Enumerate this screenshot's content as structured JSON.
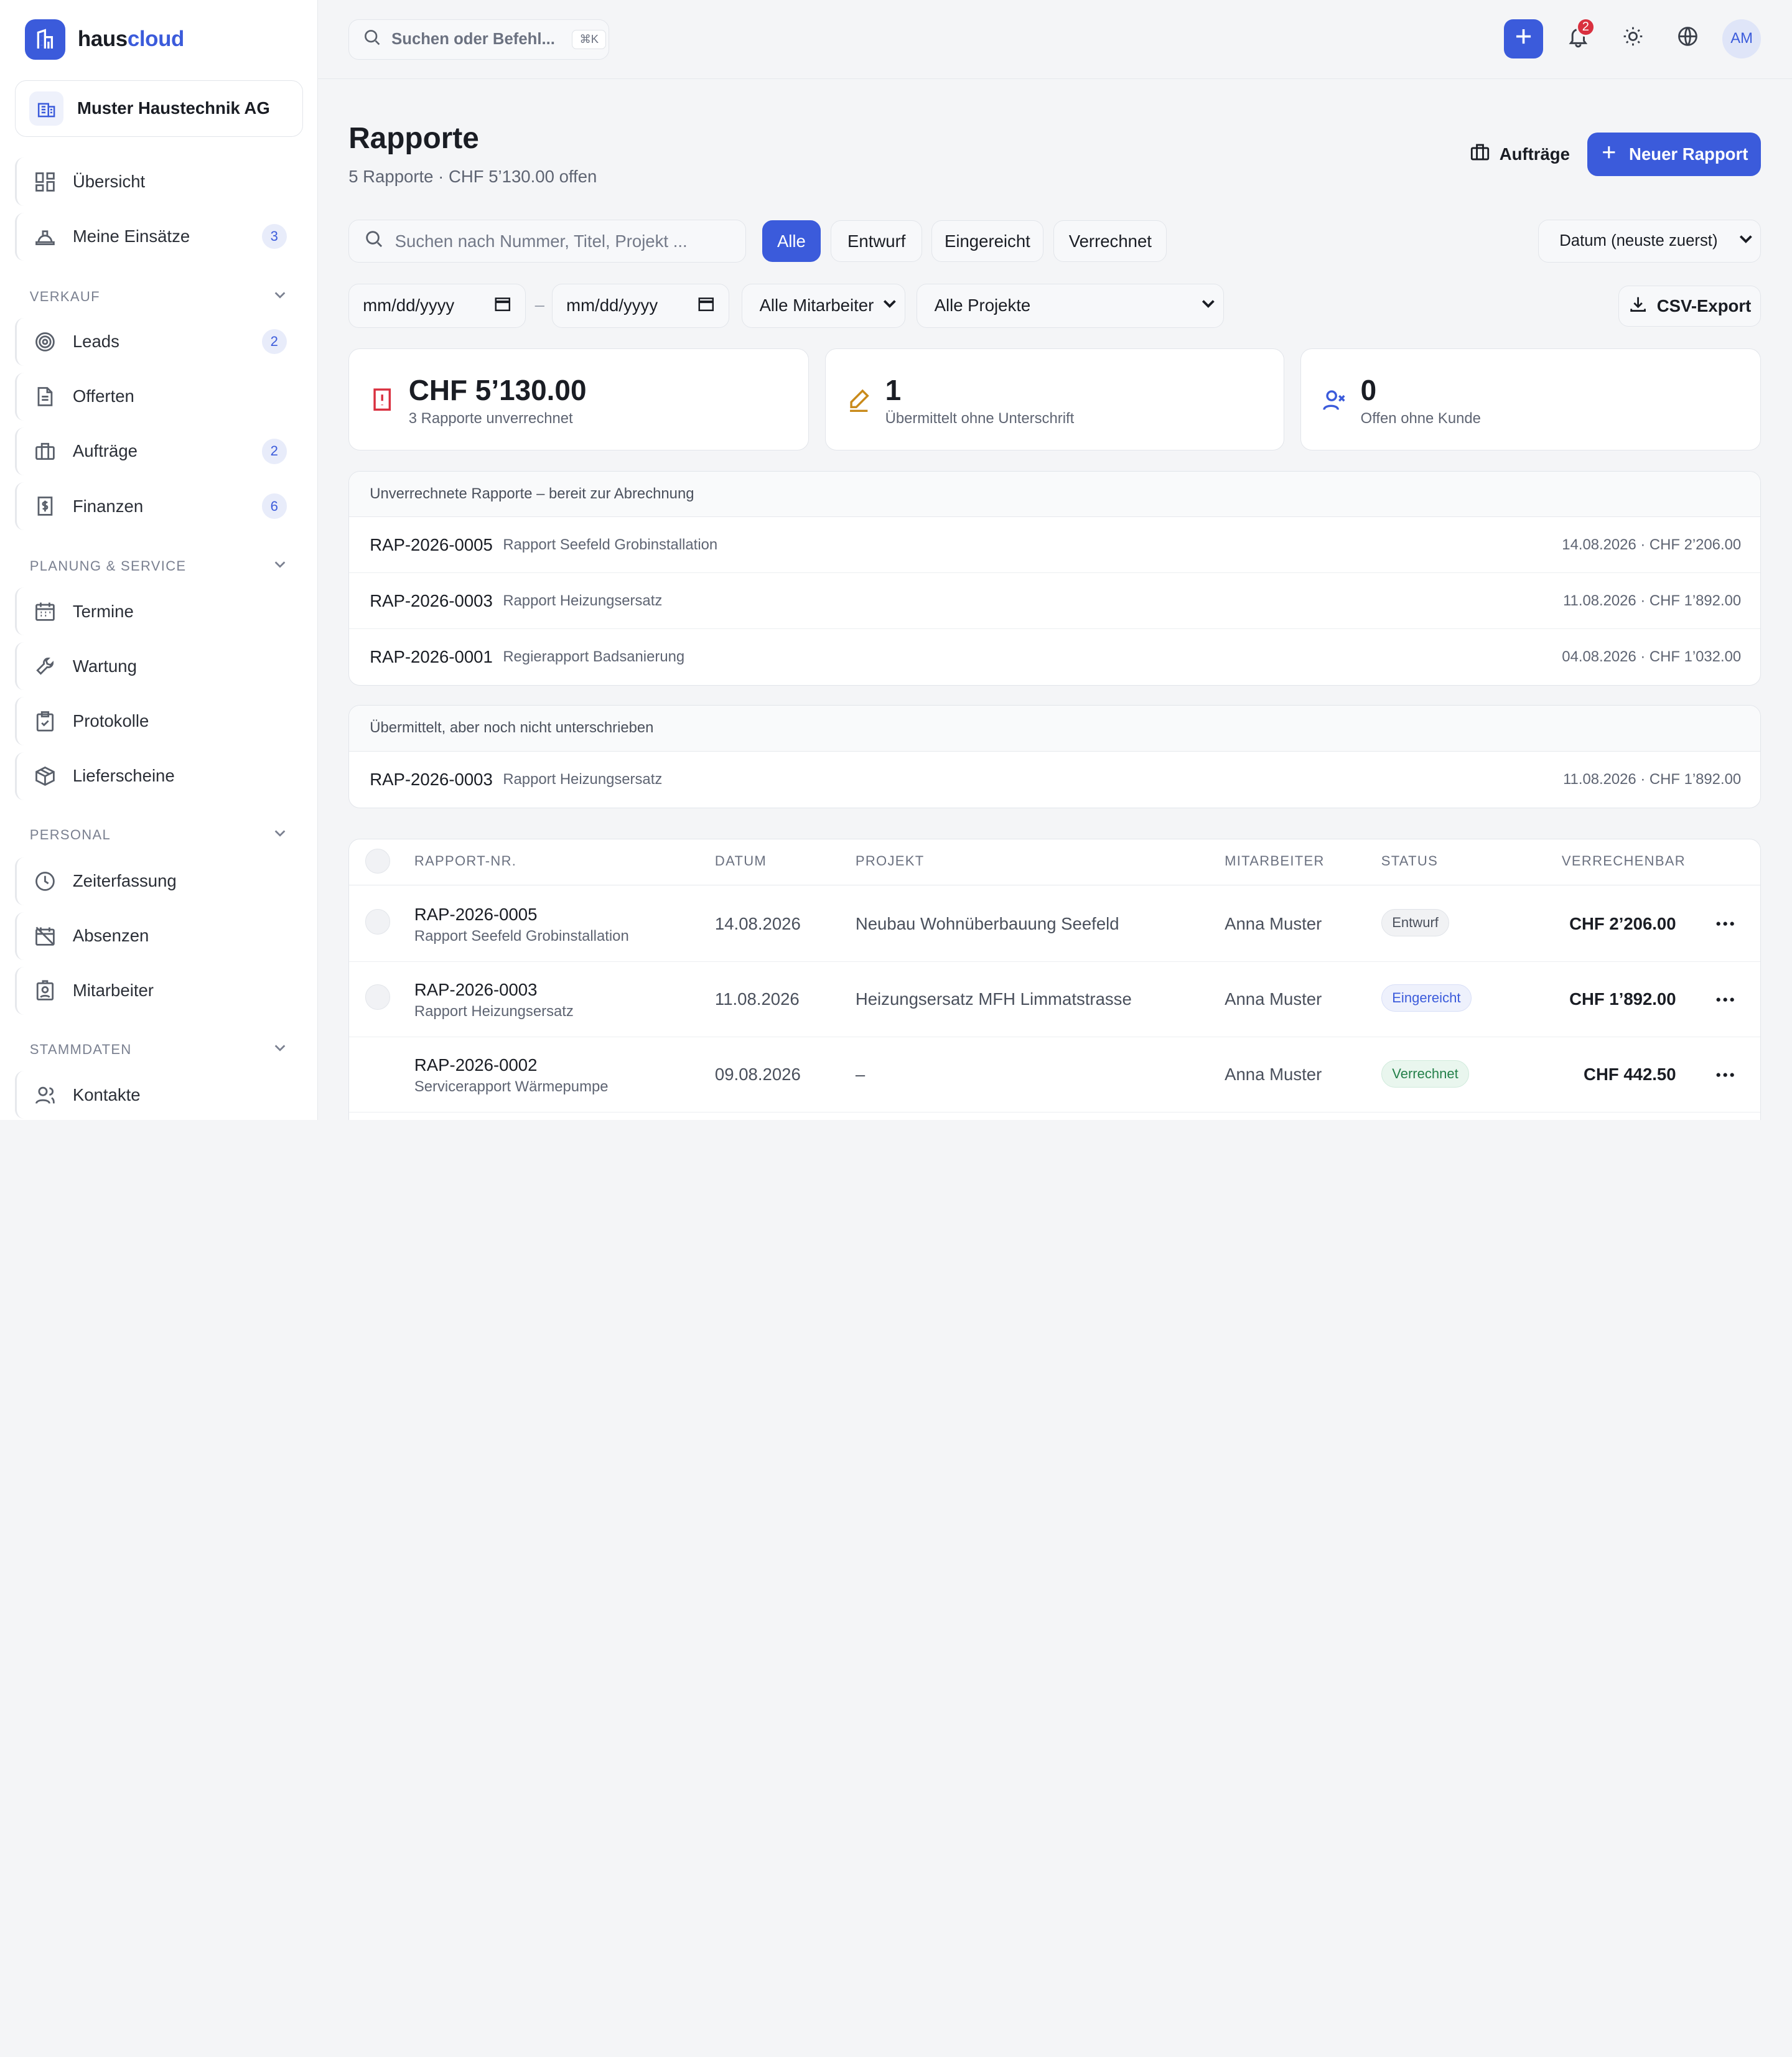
{
  "brand": {
    "part1": "haus",
    "part2": "cloud"
  },
  "company": {
    "name": "Muster Haustechnik AG"
  },
  "nav": {
    "uebersicht": {
      "label": "Übersicht"
    },
    "einsaetze": {
      "label": "Meine Einsätze",
      "count": "3"
    },
    "section_verkauf": "VERKAUF",
    "leads": {
      "label": "Leads",
      "count": "2"
    },
    "offerten": {
      "label": "Offerten"
    },
    "auftraege": {
      "label": "Aufträge",
      "count": "2"
    },
    "finanzen": {
      "label": "Finanzen",
      "count": "6"
    },
    "section_planung": "PLANUNG & SERVICE",
    "termine": {
      "label": "Termine"
    },
    "wartung": {
      "label": "Wartung"
    },
    "protokolle": {
      "label": "Protokolle"
    },
    "lieferscheine": {
      "label": "Lieferscheine"
    },
    "section_personal": "PERSONAL",
    "zeiterfassung": {
      "label": "Zeiterfassung"
    },
    "absenzen": {
      "label": "Absenzen"
    },
    "mitarbeiter": {
      "label": "Mitarbeiter"
    },
    "section_stammdaten": "STAMMDATEN",
    "kontakte": {
      "label": "Kontakte"
    }
  },
  "topbar": {
    "command_placeholder": "Suchen oder Befehl...",
    "command_shortcut": "⌘K",
    "notifications_count": "2",
    "avatar_initials": "AM"
  },
  "page": {
    "title": "Rapporte",
    "subtitle": "5 Rapporte · CHF 5’130.00 offen",
    "auftraege_button": "Aufträge",
    "new_button": "Neuer Rapport"
  },
  "filters": {
    "search_placeholder": "Suchen nach Nummer, Titel, Projekt ...",
    "chips": [
      "Alle",
      "Entwurf",
      "Eingereicht",
      "Verrechnet"
    ],
    "active_chip": "Alle",
    "sort_selected": "Datum (neuste zuerst)",
    "date_from": "mm/dd/yyyy",
    "date_to": "mm/dd/yyyy",
    "date_separator": "–",
    "employee_selected": "Alle Mitarbeiter",
    "project_selected": "Alle Projekte",
    "csv_export": "CSV-Export"
  },
  "stats": [
    {
      "value": "CHF 5’130.00",
      "label": "3 Rapporte unverrechnet"
    },
    {
      "value": "1",
      "label": "Übermittelt ohne Unterschrift"
    },
    {
      "value": "0",
      "label": "Offen ohne Kunde"
    }
  ],
  "unbilled_panel": {
    "heading": "Unverrechnete Rapporte – bereit zur Abrechnung",
    "rows": [
      {
        "number": "RAP-2026-0005",
        "title": "Rapport Seefeld Grobinstallation",
        "meta": "14.08.2026 · CHF 2’206.00"
      },
      {
        "number": "RAP-2026-0003",
        "title": "Rapport Heizungsersatz",
        "meta": "11.08.2026 · CHF 1’892.00"
      },
      {
        "number": "RAP-2026-0001",
        "title": "Regierapport Badsanierung",
        "meta": "04.08.2026 · CHF 1’032.00"
      }
    ]
  },
  "unsigned_panel": {
    "heading": "Übermittelt, aber noch nicht unterschrieben",
    "rows": [
      {
        "number": "RAP-2026-0003",
        "title": "Rapport Heizungsersatz",
        "meta": "11.08.2026 · CHF 1’892.00"
      }
    ]
  },
  "table": {
    "columns": {
      "nr": "RAPPORT-NR.",
      "datum": "DATUM",
      "projekt": "PROJEKT",
      "mitarbeiter": "MITARBEITER",
      "status": "STATUS",
      "verrechenbar": "VERRECHENBAR"
    },
    "rows": [
      {
        "number": "RAP-2026-0005",
        "title": "Rapport Seefeld Grobinstallation",
        "date": "14.08.2026",
        "project": "Neubau Wohnüberbauung Seefeld",
        "employee": "Anna Muster",
        "status": "Entwurf",
        "amount": "CHF 2’206.00"
      },
      {
        "number": "RAP-2026-0003",
        "title": "Rapport Heizungsersatz",
        "date": "11.08.2026",
        "project": "Heizungsersatz MFH Limmatstrasse",
        "employee": "Anna Muster",
        "status": "Eingereicht",
        "amount": "CHF 1’892.00"
      },
      {
        "number": "RAP-2026-0002",
        "title": "Servicerapport Wärmepumpe",
        "date": "09.08.2026",
        "project": "–",
        "employee": "Anna Muster",
        "status": "Verrechnet",
        "amount": "CHF 442.50"
      }
    ]
  },
  "colors": {
    "accent": "#3b5bdb",
    "danger": "#d9303f",
    "warning": "#c98a1a"
  }
}
